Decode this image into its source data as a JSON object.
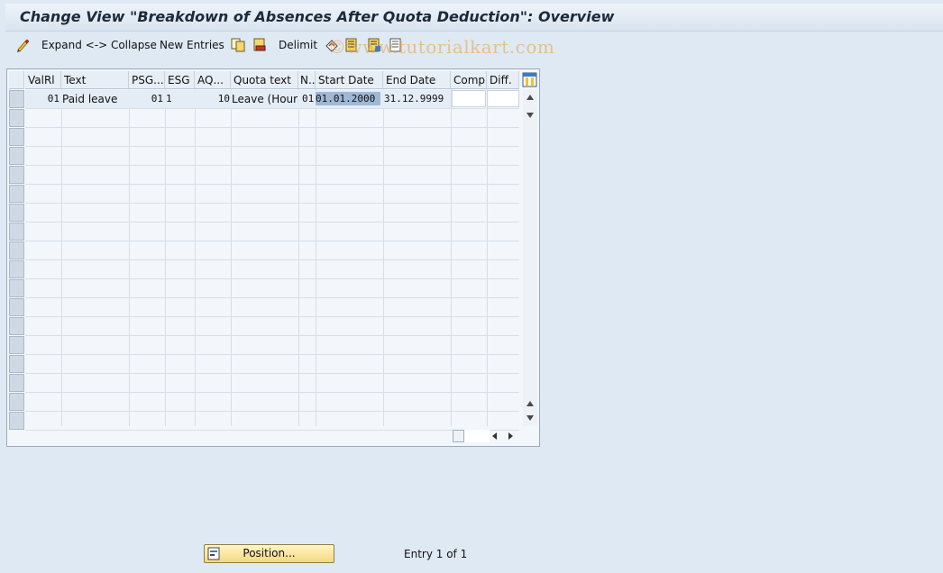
{
  "window": {
    "title": "Change View \"Breakdown of Absences After Quota Deduction\": Overview"
  },
  "toolbar": {
    "expand_collapse": "Expand <-> Collapse",
    "new_entries": "New Entries",
    "delimit": "Delimit",
    "watermark": "©www.tutorialkart.com"
  },
  "table": {
    "columns": [
      "ValRl",
      "Text",
      "PSG...",
      "ESG",
      "AQ...",
      "Quota text",
      "N..",
      "Start Date",
      "End Date",
      "Comp.",
      "Diff."
    ],
    "rows": [
      {
        "valrl": "01",
        "text": "Paid leave",
        "psg": "01",
        "esg": "1",
        "aq": "10",
        "quota_text": "Leave (Hour…",
        "n": "01",
        "start_date": "01.01.2000",
        "end_date": "31.12.9999",
        "comp": "",
        "diff": ""
      }
    ],
    "highlight_color": "#9fb8d6",
    "grid_line_color": "#d6dee8"
  },
  "footer": {
    "position_button": "Position...",
    "entry_text": "Entry 1 of 1"
  },
  "colors": {
    "background": "#dfe9f4",
    "button": "#f3d980",
    "watermark": "#e6a23c"
  }
}
